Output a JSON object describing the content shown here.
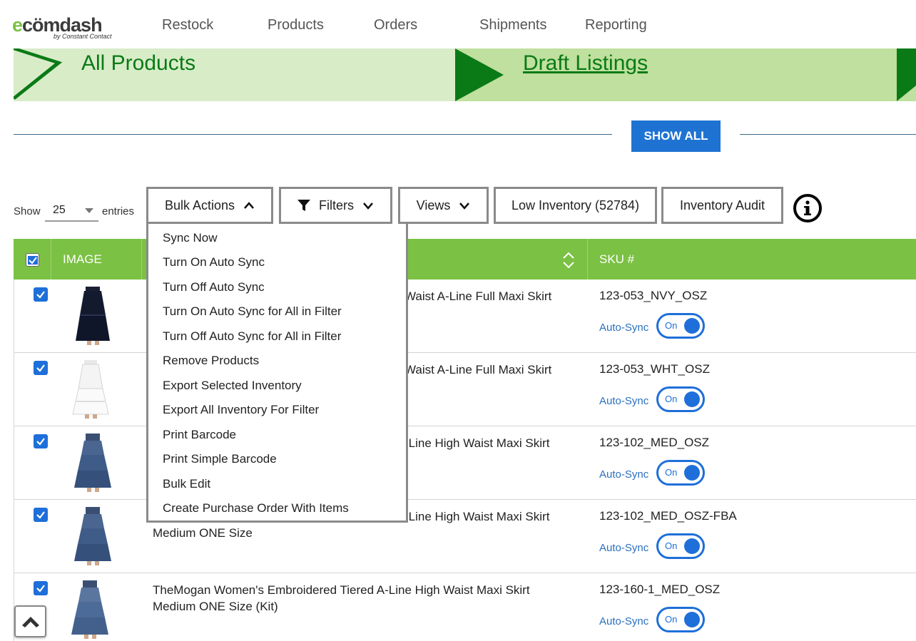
{
  "brand": {
    "logo_main_prefix": "e",
    "logo_main_rest": "cömdash",
    "logo_sub": "by Constant Contact"
  },
  "nav": {
    "items": [
      {
        "label": "Restock"
      },
      {
        "label": "Products"
      },
      {
        "label": "Orders"
      },
      {
        "label": "Shipments"
      },
      {
        "label": "Reporting"
      }
    ]
  },
  "banner": {
    "left_title": "All Products",
    "right_link": "Draft Listings"
  },
  "show_all_label": "SHOW ALL",
  "entries": {
    "show_label": "Show",
    "value": "25",
    "suffix": "entries"
  },
  "toolbar": {
    "bulk_actions": "Bulk Actions",
    "filters": "Filters",
    "views": "Views",
    "low_inventory": "Low Inventory (52784)",
    "inventory_audit": "Inventory Audit"
  },
  "table": {
    "headers": {
      "image": "IMAGE",
      "sku": "SKU #"
    },
    "rows": [
      {
        "name": "TheMogan Women's Embroidered Tiered High Waist A-Line Full Maxi Skirt",
        "name_visible": "Waist A-Line Full Maxi Skirt",
        "sku": "123-053_NVY_OSZ",
        "autosync": "Auto-Sync",
        "toggle": "On",
        "image": "navy-skirt-image"
      },
      {
        "name": "TheMogan Women's Embroidered Tiered High Waist A-Line Full Maxi Skirt",
        "name_visible": "Waist A-Line Full Maxi Skirt",
        "sku": "123-053_WHT_OSZ",
        "autosync": "Auto-Sync",
        "toggle": "On",
        "image": "white-skirt-image"
      },
      {
        "name": "TheMogan Women's Embroidered Tiered A-Line High Waist Maxi Skirt",
        "name_visible": "-Line High Waist Maxi Skirt",
        "sku": "123-102_MED_OSZ",
        "autosync": "Auto-Sync",
        "toggle": "On",
        "image": "denim-skirt-image"
      },
      {
        "name": "TheMogan Women's Embroidered Tiered A-Line High Waist Maxi Skirt",
        "name_visible": "-Line High Waist Maxi Skirt",
        "name_line2": "Medium ONE Size",
        "sku": "123-102_MED_OSZ-FBA",
        "autosync": "Auto-Sync",
        "toggle": "On",
        "image": "denim-skirt-image"
      },
      {
        "name_line1": "TheMogan Women's Embroidered Tiered A-Line High Waist Maxi Skirt",
        "name_line2": "Medium ONE Size (Kit)",
        "sku": "123-160-1_MED_OSZ",
        "autosync": "Auto-Sync",
        "toggle": "On",
        "image": "denim-skirt-image"
      }
    ]
  },
  "bulk_menu": {
    "items": [
      "Sync Now",
      "Turn On Auto Sync",
      "Turn Off Auto Sync",
      "Turn On Auto Sync for All in Filter",
      "Turn Off Auto Sync for All in Filter",
      "Remove Products",
      "Export Selected Inventory",
      "Export All Inventory For Filter",
      "Print Barcode",
      "Print Simple Barcode",
      "Bulk Edit",
      "Create Purchase Order With Items"
    ]
  },
  "colors": {
    "accent_green": "#7bc144",
    "dark_green": "#0a7a16",
    "blue": "#1e73d2"
  }
}
